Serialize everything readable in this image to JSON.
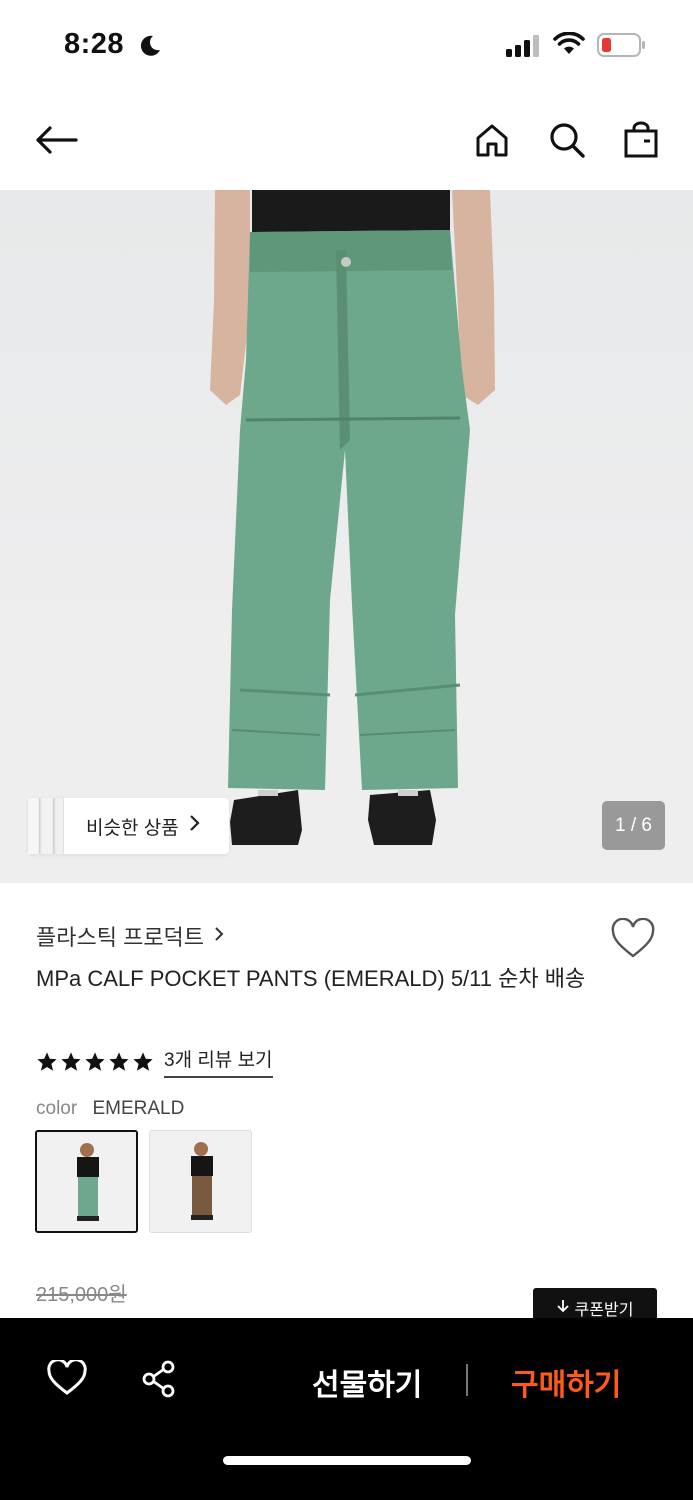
{
  "status": {
    "time": "8:28"
  },
  "hero": {
    "similar_label": "비슷한 상품",
    "image_counter": "1 / 6"
  },
  "product": {
    "brand": "플라스틱 프로덕트",
    "name": "MPa CALF POCKET PANTS (EMERALD) 5/11 순차 배송",
    "rating": 5,
    "review_link": "3개 리뷰 보기",
    "color_label": "color",
    "color_value": "EMERALD",
    "original_price": "215,000원",
    "coupon_label": "쿠폰받기"
  },
  "bottom_bar": {
    "gift_label": "선물하기",
    "buy_label": "구매하기"
  },
  "colors": {
    "buy_accent": "#ff5a1a",
    "pants_emerald": "#6ea88c",
    "pants_brown": "#7a5a3e"
  }
}
